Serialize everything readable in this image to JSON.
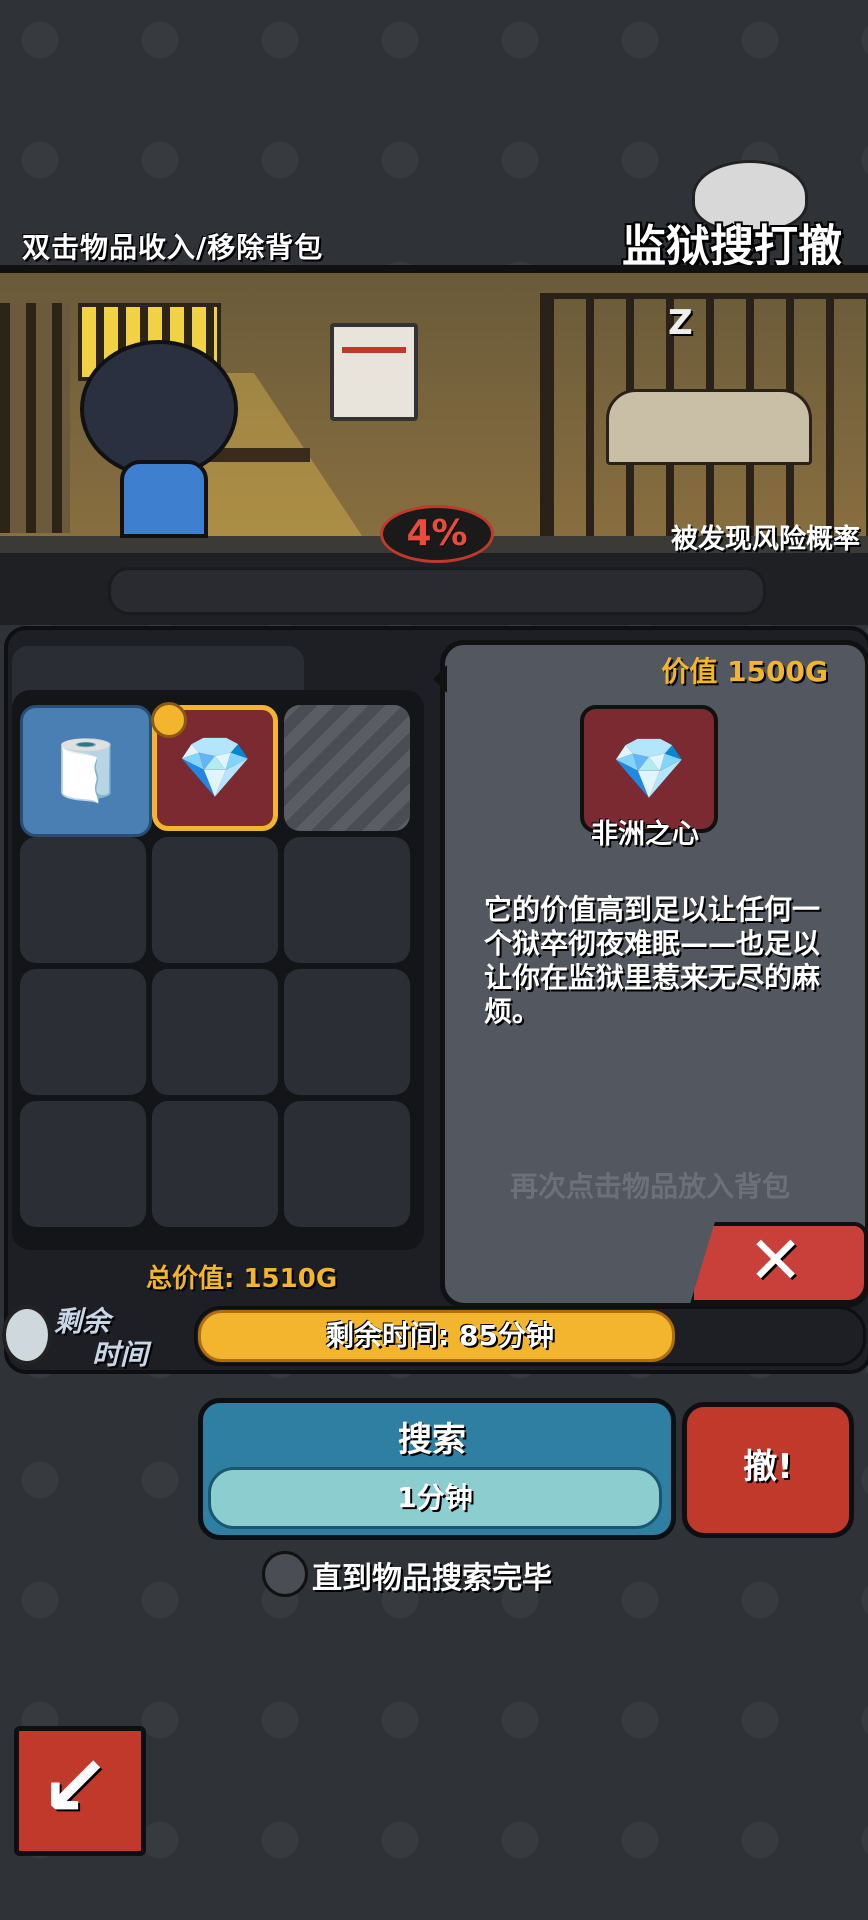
{
  "header": {
    "hint": "双击物品收入/移除背包",
    "title": "监狱搜打撤"
  },
  "scene": {
    "risk_value": "4%",
    "risk_label": "被发现风险概率",
    "sleep_icon": "Z"
  },
  "inventory": {
    "cells": [
      {
        "state": "filled",
        "icon": "toilet-paper-icon"
      },
      {
        "state": "selected",
        "icon": "gem-icon"
      },
      {
        "state": "locked"
      },
      {
        "state": "empty"
      },
      {
        "state": "empty"
      },
      {
        "state": "empty"
      },
      {
        "state": "empty"
      },
      {
        "state": "empty"
      },
      {
        "state": "empty"
      },
      {
        "state": "empty"
      },
      {
        "state": "empty"
      },
      {
        "state": "empty"
      }
    ],
    "total": "总价值: 1510G"
  },
  "detail": {
    "value": "价值 1500G",
    "item_name": "非洲之心",
    "description": "它的价值高到足以让任何一个狱卒彻夜难眠——也足以让你在监狱里惹来无尽的麻烦。",
    "tap_hint": "再次点击物品放入背包",
    "close_label": "✕"
  },
  "timer": {
    "label_line1": "剩余",
    "label_line2": "时间",
    "text": "剩余时间: 85分钟",
    "progress": 0.71
  },
  "actions": {
    "search_label": "搜索",
    "search_duration": "1分钟",
    "flee_label": "撤!",
    "toggle_label": "直到物品搜索完毕",
    "back_label": "↙"
  },
  "colors": {
    "accent_gold": "#f4b52e",
    "danger_red": "#c0392b",
    "search_blue": "#2f7fa3"
  }
}
